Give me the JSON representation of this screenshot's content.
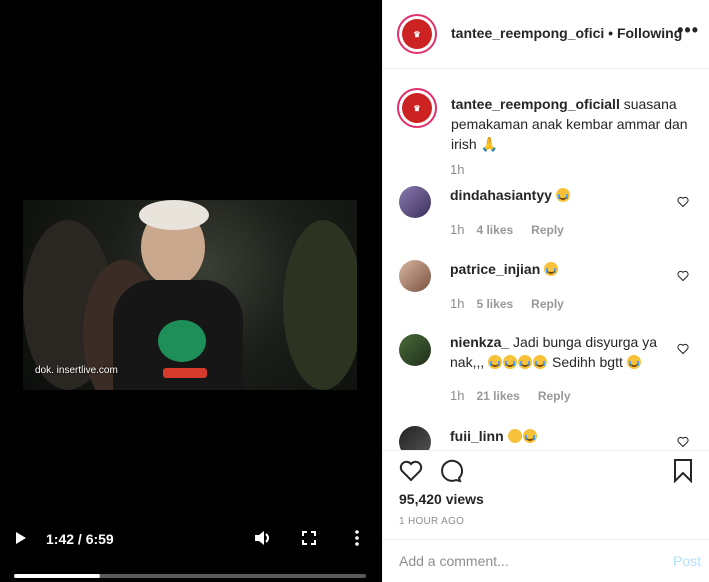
{
  "video": {
    "watermark": "dok. insertlive.com",
    "time": "1:42 / 6:59",
    "progress": 0.245
  },
  "header": {
    "username": "tantee_reempong_ofici",
    "separator": " • ",
    "follow_label": "Following",
    "more_label": "•••"
  },
  "caption": {
    "username": "tantee_reempong_oficiall",
    "text": " suasana pemakaman anak kembar ammar dan irish 🙏",
    "time": "1h"
  },
  "comments": [
    {
      "user": "dindahasiantyy",
      "text": "",
      "emojis": 1,
      "time": "1h",
      "likes": "4 likes",
      "reply": "Reply"
    },
    {
      "user": "patrice_injian",
      "text": "",
      "emojis": 1,
      "time": "1h",
      "likes": "5 likes",
      "reply": "Reply"
    },
    {
      "user": "nienkza_",
      "text": " Jadi bunga disyurga ya nak,,, ",
      "text2": " Sedihh bgtt ",
      "time": "1h",
      "likes": "21 likes",
      "reply": "Reply"
    },
    {
      "user": "fuii_linn",
      "text": "",
      "time": "",
      "likes": "",
      "reply": ""
    }
  ],
  "stats": {
    "views": "95,420 views",
    "ago": "1 HOUR AGO"
  },
  "comment_box": {
    "placeholder": "Add a comment...",
    "post_label": "Post"
  },
  "colors": {
    "accent": "#e1306c",
    "post_disabled": "#b2dffc",
    "muted": "#8e8e8e"
  }
}
